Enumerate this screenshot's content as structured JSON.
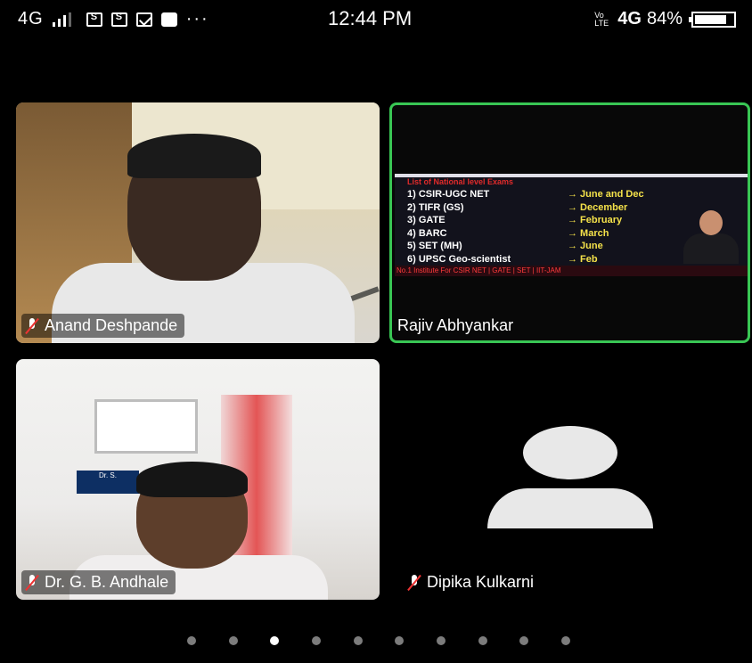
{
  "status_bar": {
    "network": "4G",
    "time": "12:44 PM",
    "volte": "Vo LTE",
    "network_right": "4G",
    "battery_percent": "84%",
    "battery_level": 0.84,
    "notification_icons": [
      "sim-icon",
      "sim-icon",
      "mail-icon",
      "bag-icon"
    ],
    "more": "···"
  },
  "participants": [
    {
      "name": "Anand Deshpande",
      "muted": true
    },
    {
      "name": "Rajiv Abhyankar",
      "muted": false,
      "active_speaker": true,
      "color": "#39c654"
    },
    {
      "name": "Dr. G. B. Andhale",
      "muted": true
    },
    {
      "name": "Dipika Kulkarni",
      "muted": true,
      "video_off": true
    }
  ],
  "slide": {
    "title": "List of National level Exams",
    "items": [
      {
        "left": "1) CSIR-UGC NET",
        "right": "→ June and Dec"
      },
      {
        "left": "2) TIFR (GS)",
        "right": "→ December"
      },
      {
        "left": "3) GATE",
        "right": "→ February"
      },
      {
        "left": "4) BARC",
        "right": "→ March"
      },
      {
        "left": "5) SET (MH)",
        "right": "→ June"
      },
      {
        "left": "6) UPSC Geo-scientist",
        "right": "→ Feb"
      }
    ],
    "footer": "No.1 Institute For CSIR NET | GATE | SET | IIT-JAM"
  },
  "scene3": {
    "nameplate": "Dr. S."
  },
  "pager": {
    "count": 10,
    "active_index": 2
  }
}
